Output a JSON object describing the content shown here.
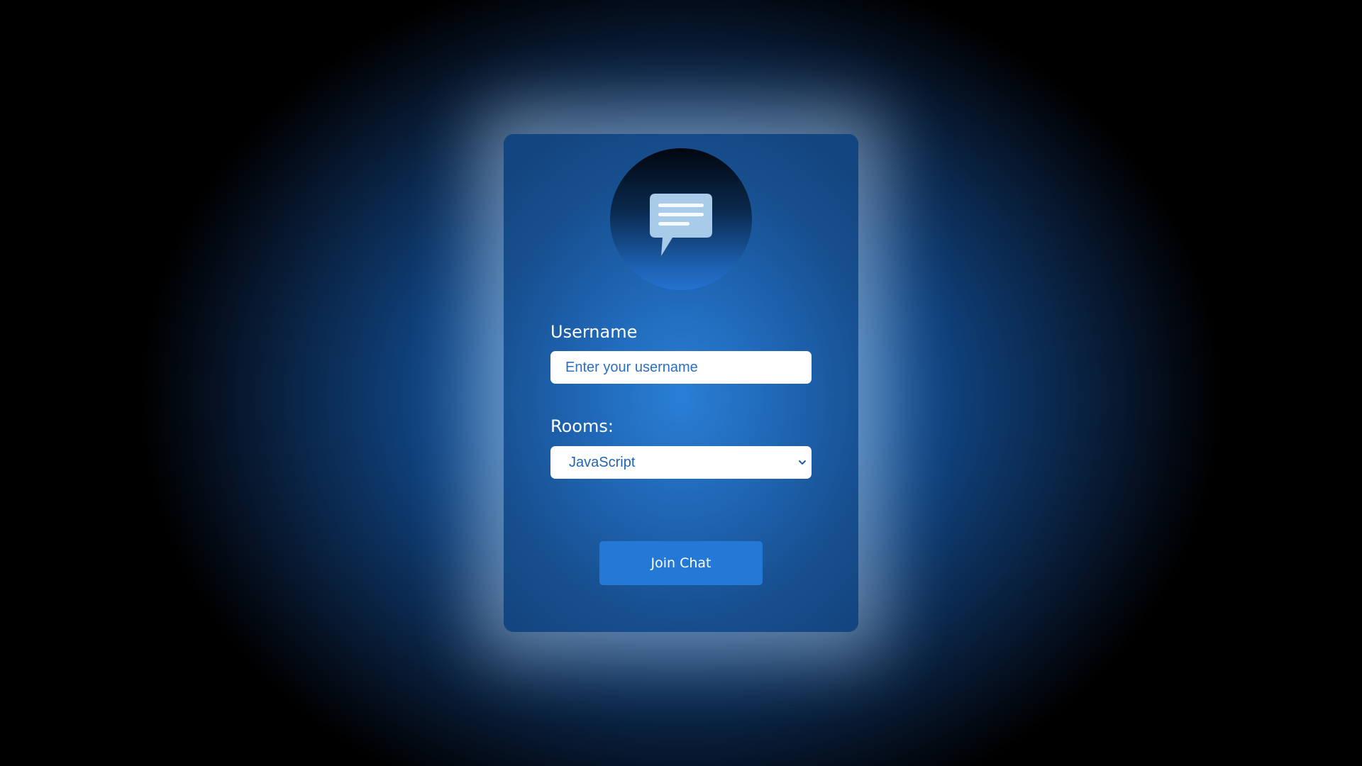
{
  "form": {
    "username_label": "Username",
    "username_placeholder": "Enter your username",
    "username_value": "",
    "rooms_label": "Rooms:",
    "rooms_selected": "JavaScript",
    "join_button_label": "Join Chat"
  },
  "icons": {
    "avatar": "chat-bubble-icon",
    "select_arrow": "chevron-down-icon"
  },
  "colors": {
    "accent": "#2479d6",
    "field_text": "#1f66b4",
    "chat_icon": "#a7cbe8"
  }
}
